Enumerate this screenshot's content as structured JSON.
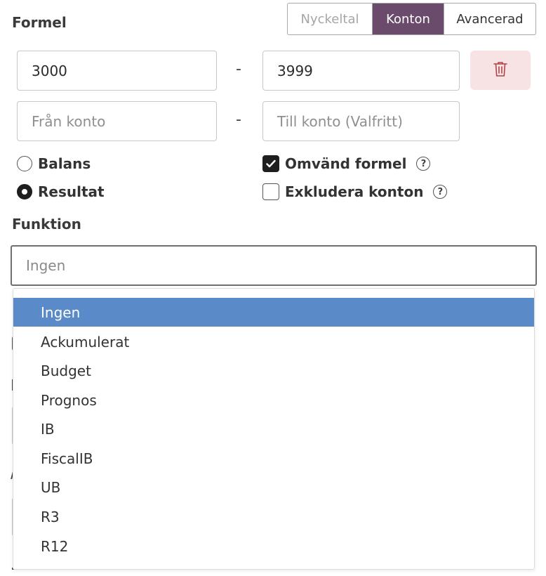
{
  "formula": {
    "title": "Formel",
    "tabs": [
      {
        "label": "Nyckeltal",
        "state": "disabled"
      },
      {
        "label": "Konton",
        "state": "active"
      },
      {
        "label": "Avancerad",
        "state": "normal"
      }
    ],
    "row1": {
      "from_value": "3000",
      "separator": "-",
      "to_value": "3999"
    },
    "row2": {
      "from_placeholder": "Från konto",
      "separator": "-",
      "to_placeholder": "Till konto (Valfritt)"
    },
    "delete_icon": "trash-icon",
    "radios": [
      {
        "label": "Balans",
        "checked": false
      },
      {
        "label": "Resultat",
        "checked": true
      }
    ],
    "checkboxes": [
      {
        "label": "Omvänd formel",
        "checked": true,
        "help": "?"
      },
      {
        "label": "Exkludera konton",
        "checked": false,
        "help": "?"
      }
    ]
  },
  "function": {
    "title": "Funktion",
    "selected": "Ingen",
    "options": [
      "Ingen",
      "Ackumulerat",
      "Budget",
      "Prognos",
      "IB",
      "FiscalIB",
      "UB",
      "R3",
      "R12"
    ]
  },
  "colors": {
    "accent": "#6b4b6b",
    "highlight": "#5b8ac8",
    "delete_bg": "#f7e3e3",
    "delete_icon": "#b0424a"
  }
}
